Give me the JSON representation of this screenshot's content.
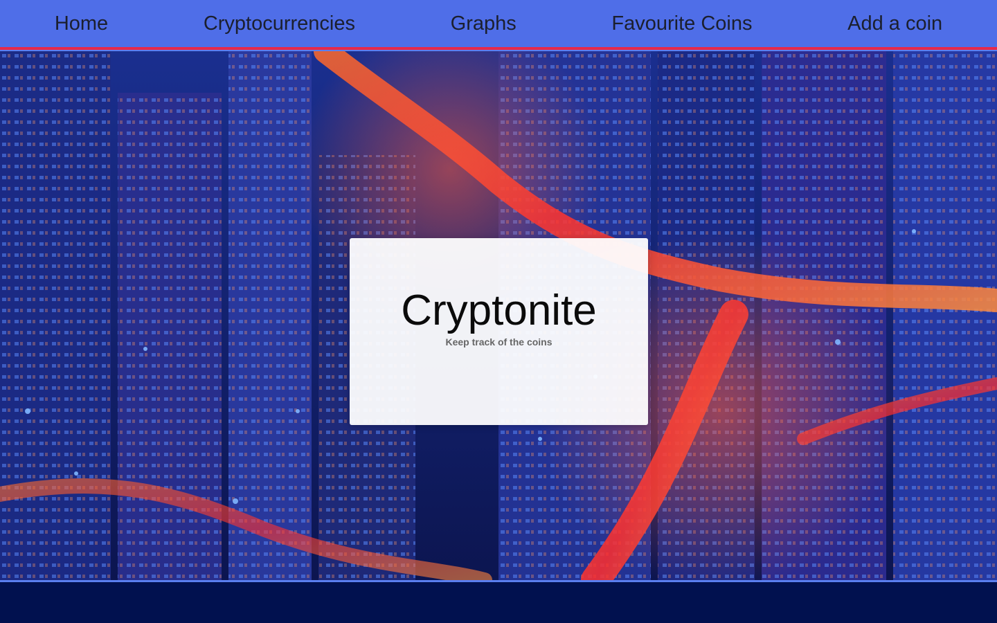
{
  "nav": {
    "items": [
      {
        "label": "Home"
      },
      {
        "label": "Cryptocurrencies"
      },
      {
        "label": "Graphs"
      },
      {
        "label": "Favourite Coins"
      },
      {
        "label": "Add a coin"
      }
    ]
  },
  "hero": {
    "title": "Cryptonite",
    "subtitle": "Keep track of the coins",
    "background_image": "night-city-highway-photo"
  },
  "colors": {
    "nav_bg": "#4f6ee8",
    "nav_accent": "#e8294a",
    "footer_bg": "#01114f"
  }
}
